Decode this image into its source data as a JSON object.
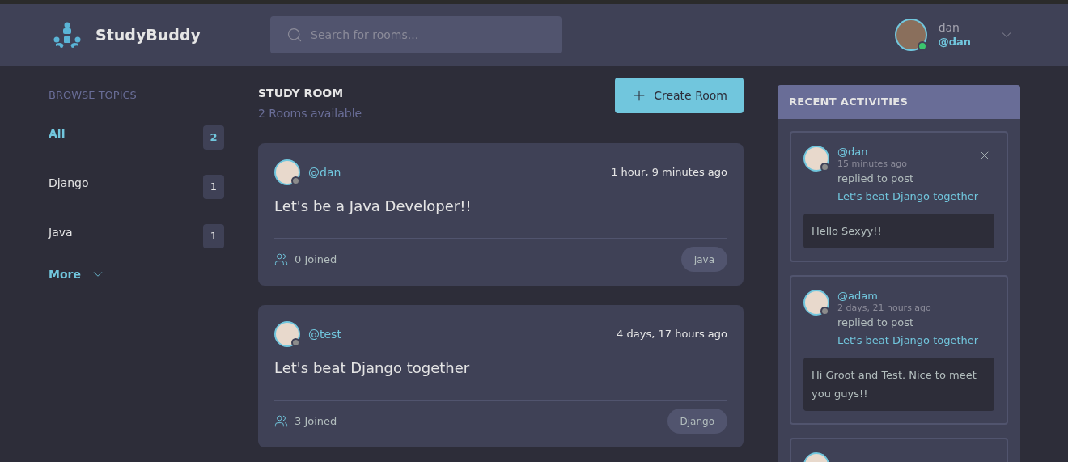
{
  "header": {
    "brand": "StudyBuddy",
    "search": {
      "placeholder": "Search for rooms..."
    },
    "user": {
      "name": "dan",
      "handle": "@dan",
      "online": true
    }
  },
  "topics": {
    "title": "BROWSE TOPICS",
    "items": [
      {
        "label": "All",
        "count": "2",
        "selected": true
      },
      {
        "label": "Django",
        "count": "1",
        "selected": false
      },
      {
        "label": "Java",
        "count": "1",
        "selected": false
      }
    ],
    "more": "More"
  },
  "rooms": {
    "title": "STUDY ROOM",
    "subtitle": "2 Rooms available",
    "create_button": "Create Room",
    "items": [
      {
        "host": "@dan",
        "host_online": false,
        "time": "1 hour, 9 minutes ago",
        "name": "Let's be a Java Developer!!",
        "joined": "0 Joined",
        "topic": "Java"
      },
      {
        "host": "@test",
        "host_online": false,
        "time": "4 days, 17 hours ago",
        "name": "Let's beat Django together",
        "joined": "3 Joined",
        "topic": "Django"
      }
    ]
  },
  "activities": {
    "title": "RECENT ACTIVITIES",
    "items": [
      {
        "user": "@dan",
        "online": false,
        "time": "15 minutes ago",
        "action": "replied to post",
        "post": "Let's beat Django together",
        "message": "Hello Sexyy!!",
        "closable": true
      },
      {
        "user": "@adam",
        "online": false,
        "time": "2 days, 21 hours ago",
        "action": "replied to post",
        "post": "Let's beat Django together",
        "message": "Hi Groot and Test. Nice to meet you guys!!",
        "closable": false
      }
    ],
    "more_below": true
  }
}
